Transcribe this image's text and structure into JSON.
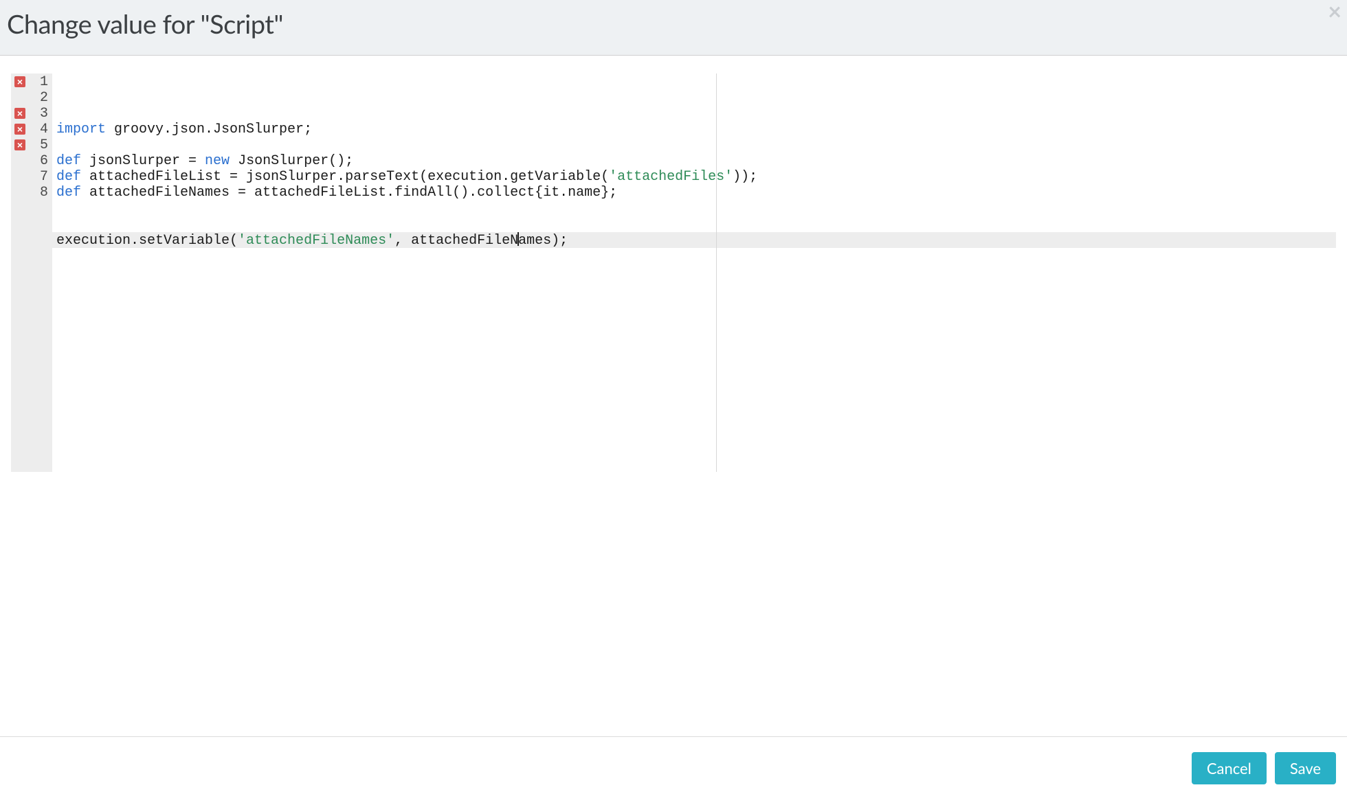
{
  "header": {
    "title": "Change value for \"Script\"",
    "close_label": "×"
  },
  "editor": {
    "guide_column": 80,
    "active_line": 8,
    "cursor_line": 8,
    "cursor_col": 56,
    "lines": [
      {
        "n": 1,
        "error": true,
        "tokens": [
          {
            "t": "import",
            "c": "kw"
          },
          {
            "t": " groovy.json.JsonSlurper;",
            "c": "def"
          }
        ]
      },
      {
        "n": 2,
        "error": false,
        "tokens": []
      },
      {
        "n": 3,
        "error": true,
        "tokens": [
          {
            "t": "def",
            "c": "kw"
          },
          {
            "t": " jsonSlurper = ",
            "c": "def"
          },
          {
            "t": "new",
            "c": "kw"
          },
          {
            "t": " JsonSlurper();",
            "c": "def"
          }
        ]
      },
      {
        "n": 4,
        "error": true,
        "tokens": [
          {
            "t": "def",
            "c": "kw"
          },
          {
            "t": " attachedFileList = jsonSlurper.parseText(execution.getVariable(",
            "c": "def"
          },
          {
            "t": "'attachedFiles'",
            "c": "str"
          },
          {
            "t": "));",
            "c": "def"
          }
        ]
      },
      {
        "n": 5,
        "error": true,
        "tokens": [
          {
            "t": "def",
            "c": "kw"
          },
          {
            "t": " attachedFileNames = attachedFileList.findAll().collect{it.name};",
            "c": "def"
          }
        ]
      },
      {
        "n": 6,
        "error": false,
        "tokens": []
      },
      {
        "n": 7,
        "error": false,
        "tokens": []
      },
      {
        "n": 8,
        "error": false,
        "tokens": [
          {
            "t": "execution.setVariable(",
            "c": "def"
          },
          {
            "t": "'attachedFileNames'",
            "c": "str"
          },
          {
            "t": ", attachedFileNames);",
            "c": "def"
          }
        ]
      }
    ]
  },
  "footer": {
    "cancel": "Cancel",
    "save": "Save"
  },
  "icons": {
    "error_glyph": "×"
  }
}
